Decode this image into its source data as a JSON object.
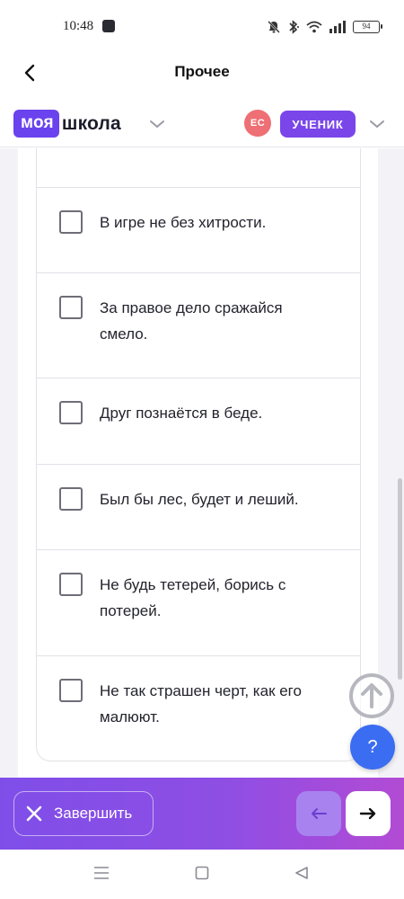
{
  "status_bar": {
    "time": "10:48",
    "battery": "94",
    "icons": [
      "notifications-off-icon",
      "bluetooth-icon",
      "wifi-icon",
      "signal-icon",
      "battery-icon"
    ]
  },
  "header": {
    "title": "Прочее",
    "back_icon": "chevron-left-icon"
  },
  "brand": {
    "logo_part1": "моя",
    "logo_part2": "школа",
    "user_initials": "ЕС",
    "role": "УЧЕНИК",
    "accent_color": "#6a42ee",
    "avatar_color": "#ee6f74"
  },
  "options": [
    {
      "label": "В игре не без хитрости.",
      "checked": false
    },
    {
      "label": "За правое дело сражайся смело.",
      "checked": false
    },
    {
      "label": "Друг познаётся в беде.",
      "checked": false
    },
    {
      "label": "Был бы лес, будет и леший.",
      "checked": false
    },
    {
      "label": "Не будь тетерей, борись с потерей.",
      "checked": false
    },
    {
      "label": "Не так страшен черт, как его малюют.",
      "checked": false
    }
  ],
  "floating": {
    "help_label": "?",
    "help_color": "#3b6df2"
  },
  "action_bar": {
    "finish_label": "Завершить",
    "prev_icon": "arrow-left-icon",
    "next_icon": "arrow-right-icon"
  },
  "system_nav": [
    "menu-icon",
    "home-icon",
    "back-triangle-icon"
  ]
}
